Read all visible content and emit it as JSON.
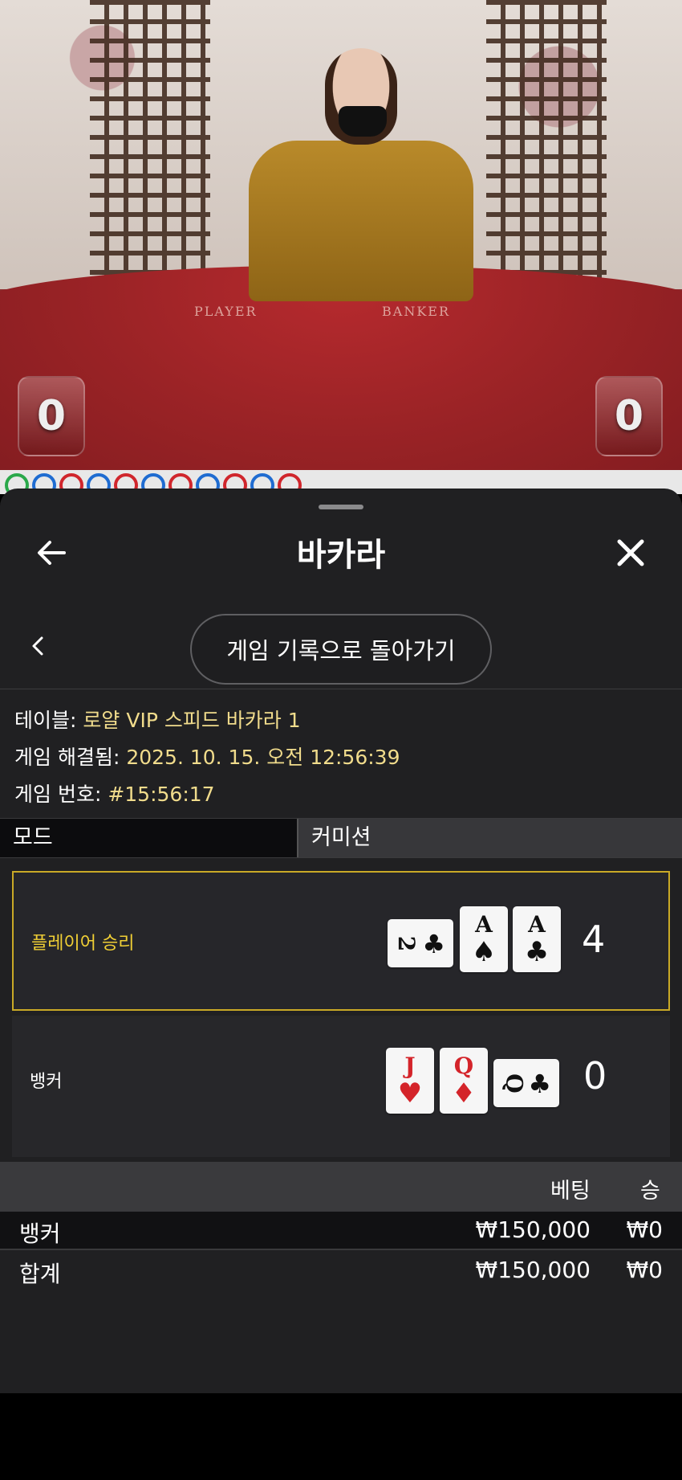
{
  "video": {
    "felt_player": "PLAYER",
    "felt_banker": "BANKER",
    "player_total": "0",
    "banker_total": "0"
  },
  "roadmap": [
    "green",
    "blue",
    "red",
    "blue",
    "red",
    "blue",
    "red",
    "blue",
    "red",
    "blue",
    "red"
  ],
  "header": {
    "back_icon": "arrow-left-icon",
    "title": "바카라",
    "close_icon": "close-icon"
  },
  "subnav": {
    "prev_icon": "chevron-left-icon",
    "history_button": "게임 기록으로 돌아가기"
  },
  "info": {
    "table_key": "테이블:",
    "table_value": "로얄 VIP 스피드 바카라 1",
    "resolved_key": "게임 해결됨:",
    "resolved_value": "2025. 10. 15. 오전 12:56:39",
    "round_key": "게임 번호:",
    "round_value": "#15:56:17"
  },
  "mode": {
    "col1": "모드",
    "col2": "커미션"
  },
  "player": {
    "label": "플레이어 승리",
    "score": "4",
    "cards": [
      {
        "rank": "2",
        "suit": "♣",
        "color": "black",
        "side": true
      },
      {
        "rank": "A",
        "suit": "♠",
        "color": "black",
        "side": false
      },
      {
        "rank": "A",
        "suit": "♣",
        "color": "black",
        "side": false
      }
    ]
  },
  "banker": {
    "label": "뱅커",
    "score": "0",
    "cards": [
      {
        "rank": "J",
        "suit": "♥",
        "color": "red",
        "side": false
      },
      {
        "rank": "Q",
        "suit": "♦",
        "color": "red",
        "side": false
      },
      {
        "rank": "Q",
        "suit": "♣",
        "color": "black",
        "side": true
      }
    ]
  },
  "bets": {
    "col_bet": "베팅",
    "col_win": "승",
    "rows": [
      {
        "name": "뱅커",
        "bet": "₩150,000",
        "win": "₩0"
      },
      {
        "name": "합계",
        "bet": "₩150,000",
        "win": "₩0"
      }
    ]
  },
  "colors": {
    "accent_yellow": "#f0cf35",
    "info_value": "#f1dc8c",
    "sheet_bg": "#202022"
  }
}
